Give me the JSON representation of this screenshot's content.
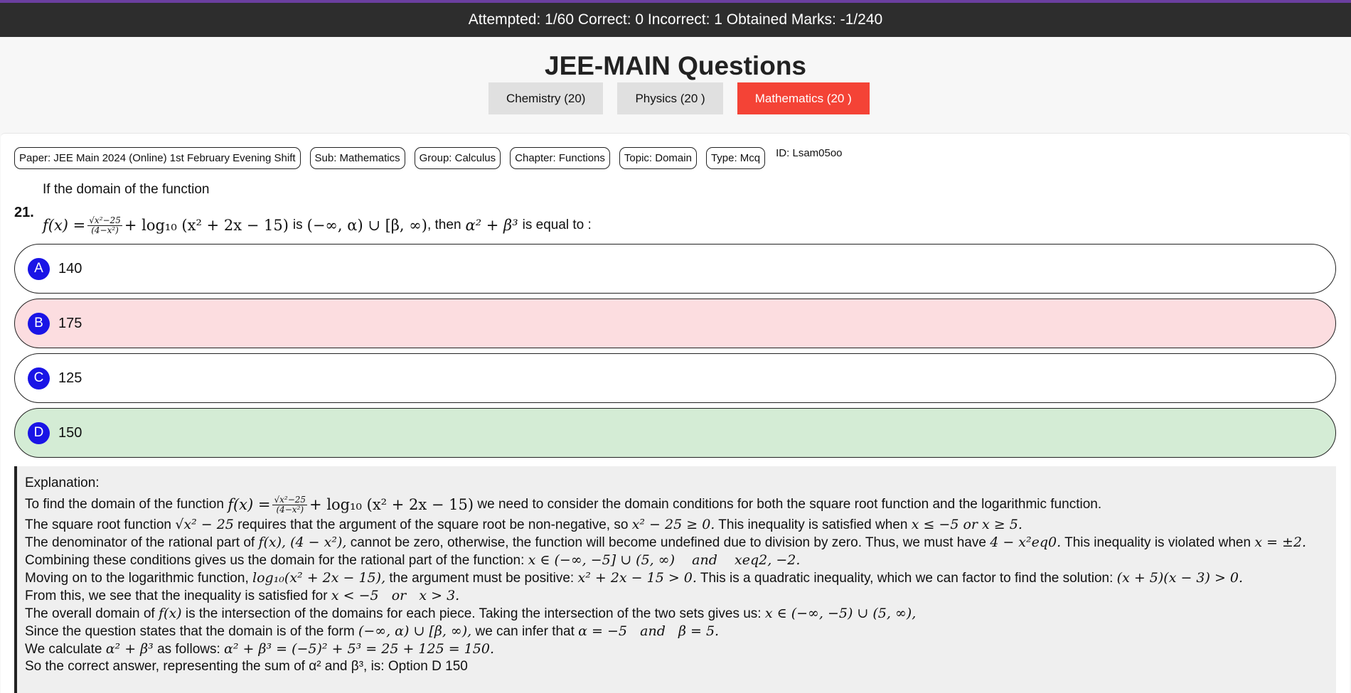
{
  "stats": {
    "text": "Attempted: 1/60 Correct: 0 Incorrect: 1 Obtained Marks: -1/240"
  },
  "page": {
    "title": "JEE-MAIN Questions"
  },
  "tabs": [
    {
      "label": "Chemistry (20)",
      "active": false
    },
    {
      "label": "Physics (20 )",
      "active": false
    },
    {
      "label": "Mathematics (20 )",
      "active": true
    }
  ],
  "tags": {
    "paper": "Paper: JEE Main 2024 (Online) 1st February Evening Shift",
    "subject": "Sub: Mathematics",
    "group": "Group: Calculus",
    "chapter": "Chapter: Functions",
    "topic": "Topic: Domain",
    "type": "Type: Mcq",
    "id": "ID: Lsam05oo"
  },
  "question": {
    "number": "21.",
    "intro": "If the domain of the function",
    "f_lhs": "f(x) =",
    "frac_num": "√x²−25",
    "frac_den": "(4−x²)",
    "log_part": "+ log₁₀ (x² + 2x − 15)",
    "is_text": "is",
    "interval": "(−∞, α) ∪ [β, ∞)",
    "then_text": ", then",
    "expr": "α² + β³",
    "tail": "is equal to :"
  },
  "options": [
    {
      "letter": "A",
      "value": "140",
      "state": "normal"
    },
    {
      "letter": "B",
      "value": "175",
      "state": "wrong"
    },
    {
      "letter": "C",
      "value": "125",
      "state": "normal"
    },
    {
      "letter": "D",
      "value": "150",
      "state": "right"
    }
  ],
  "explanation": {
    "heading": "Explanation:",
    "l1a": "To find the domain of the function",
    "l1m": "f(x) =",
    "l1n": "√x²−25",
    "l1d": "(4−x²)",
    "l1l": "+ log₁₀ (x² + 2x − 15)",
    "l1b": "we need to consider the domain conditions for both the square root function and the logarithmic function.",
    "l2a": "The square root function",
    "l2m1": "√x² − 25",
    "l2b": "requires that the argument of the square root be non-negative, so",
    "l2m2": "x² − 25 ≥ 0.",
    "l2c": "This inequality is satisfied when",
    "l2m3": "x ≤ −5   or   x ≥ 5.",
    "l3a": "The denominator of the rational part of",
    "l3m1": "f(x), (4 − x²),",
    "l3b": "cannot be zero, otherwise, the function will become undefined due to division by zero. Thus, we must have",
    "l3m2": "4 − x²eq0.",
    "l3c": "This inequality is violated when",
    "l3m3": "x = ±2.",
    "l4a": "Combining these conditions gives us the domain for the rational part of the function:",
    "l4m": "x ∈ (−∞, −5] ∪ (5, ∞)    and    xeq2, −2.",
    "l5a": "Moving on to the logarithmic function,",
    "l5m1": "log₁₀(x² + 2x − 15),",
    "l5b": "the argument must be positive:",
    "l5m2": "x² + 2x − 15 > 0.",
    "l5c": "This is a quadratic inequality, which we can factor to find the solution:",
    "l5m3": "(x + 5)(x − 3) > 0.",
    "l6a": "From this, we see that the inequality is satisfied for",
    "l6m": "x < −5   or   x > 3.",
    "l7a": "The overall domain of",
    "l7m1": "f(x)",
    "l7b": "is the intersection of the domains for each piece. Taking the intersection of the two sets gives us:",
    "l7m2": "x ∈ (−∞, −5) ∪ (5, ∞),",
    "l8a": "Since the question states that the domain is of the form",
    "l8m1": "(−∞, α) ∪ [β, ∞),",
    "l8b": "we can infer that",
    "l8m2": "α = −5   and   β = 5.",
    "l9a": "We calculate",
    "l9m1": "α² + β³",
    "l9b": "as follows:",
    "l9m2": "α² + β³ = (−5)² + 5³ = 25 + 125 = 150.",
    "l10": "So the correct answer, representing the sum of α² and β³, is: Option D 150"
  }
}
